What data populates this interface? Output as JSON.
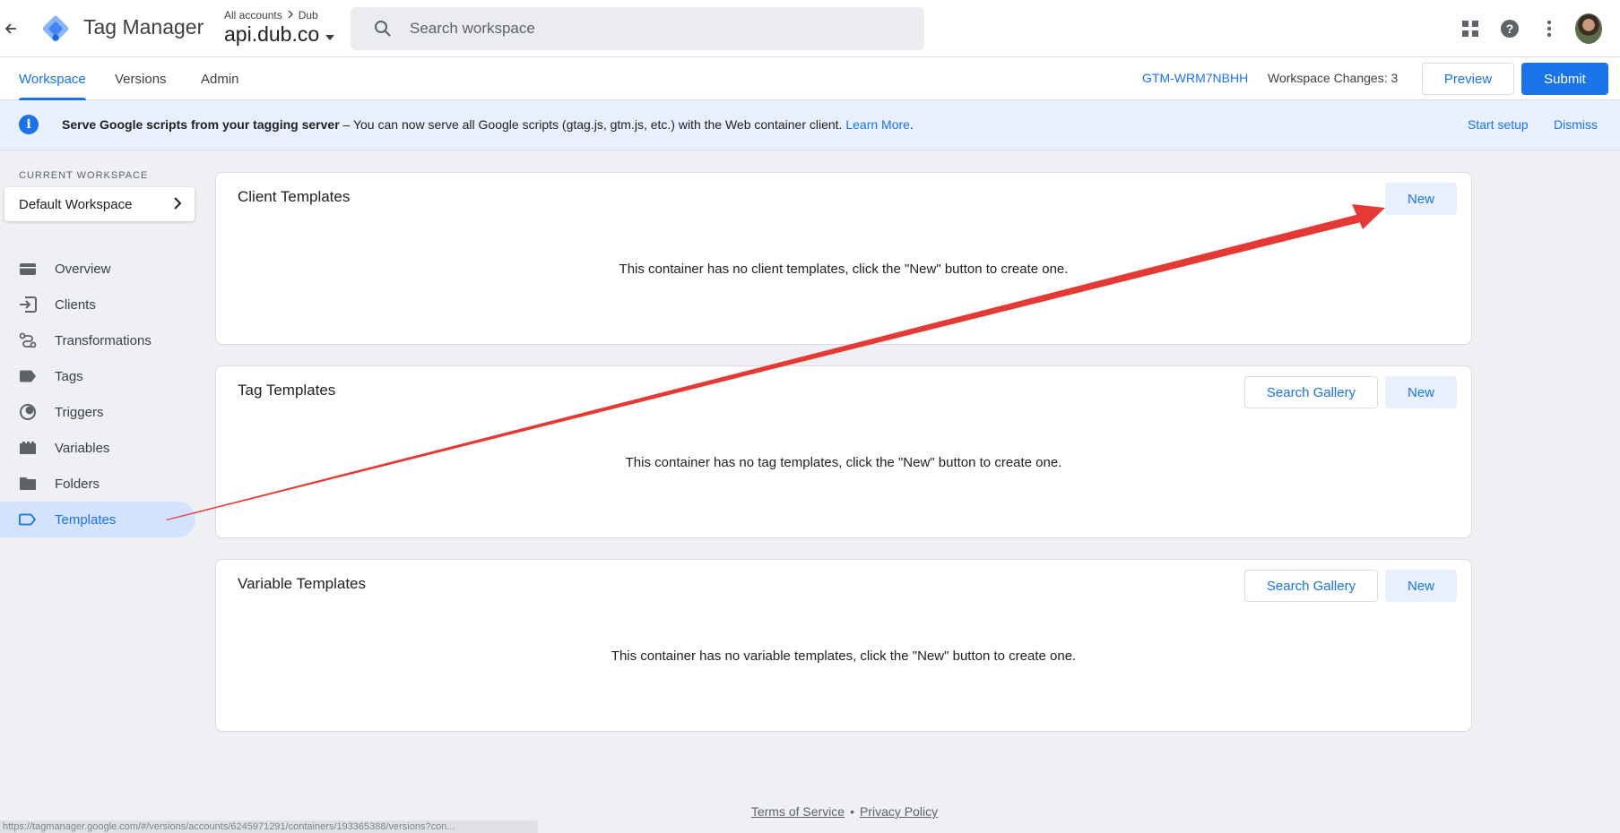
{
  "header": {
    "app_title": "Tag Manager",
    "breadcrumb_root": "All accounts",
    "breadcrumb_account": "Dub",
    "container_name": "api.dub.co",
    "search_placeholder": "Search workspace"
  },
  "tabs": [
    {
      "label": "Workspace",
      "active": true
    },
    {
      "label": "Versions",
      "active": false
    },
    {
      "label": "Admin",
      "active": false
    }
  ],
  "toolbar": {
    "container_id": "GTM-WRM7NBHH",
    "workspace_changes": "Workspace Changes: 3",
    "preview_label": "Preview",
    "submit_label": "Submit"
  },
  "banner": {
    "title": "Serve Google scripts from your tagging server",
    "text": " – You can now serve all Google scripts (gtag.js, gtm.js, etc.) with the Web container client. ",
    "learn_more": "Learn More",
    "period": ".",
    "start_setup": "Start setup",
    "dismiss": "Dismiss"
  },
  "sidebar": {
    "workspace_label": "CURRENT WORKSPACE",
    "workspace_name": "Default Workspace",
    "items": [
      {
        "label": "Overview",
        "icon": "overview-icon"
      },
      {
        "label": "Clients",
        "icon": "clients-icon"
      },
      {
        "label": "Transformations",
        "icon": "transformations-icon"
      },
      {
        "label": "Tags",
        "icon": "tag-icon"
      },
      {
        "label": "Triggers",
        "icon": "triggers-icon"
      },
      {
        "label": "Variables",
        "icon": "variables-icon"
      },
      {
        "label": "Folders",
        "icon": "folder-icon"
      },
      {
        "label": "Templates",
        "icon": "templates-icon",
        "active": true
      }
    ]
  },
  "cards": {
    "client": {
      "title": "Client Templates",
      "empty": "This container has no client templates, click the \"New\" button to create one.",
      "new_label": "New"
    },
    "tag": {
      "title": "Tag Templates",
      "empty": "This container has no tag templates, click the \"New\" button to create one.",
      "gallery_label": "Search Gallery",
      "new_label": "New"
    },
    "variable": {
      "title": "Variable Templates",
      "empty": "This container has no variable templates, click the \"New\" button to create one.",
      "gallery_label": "Search Gallery",
      "new_label": "New"
    }
  },
  "footer": {
    "terms": "Terms of Service",
    "separator": "•",
    "privacy": "Privacy Policy"
  },
  "status_url": "https://tagmanager.google.com/#/versions/accounts/6245971291/containers/193365388/versions?con...",
  "colors": {
    "accent": "#1a73e8",
    "annotation_arrow": "#e53935",
    "banner_bg": "#e8f0fe"
  }
}
